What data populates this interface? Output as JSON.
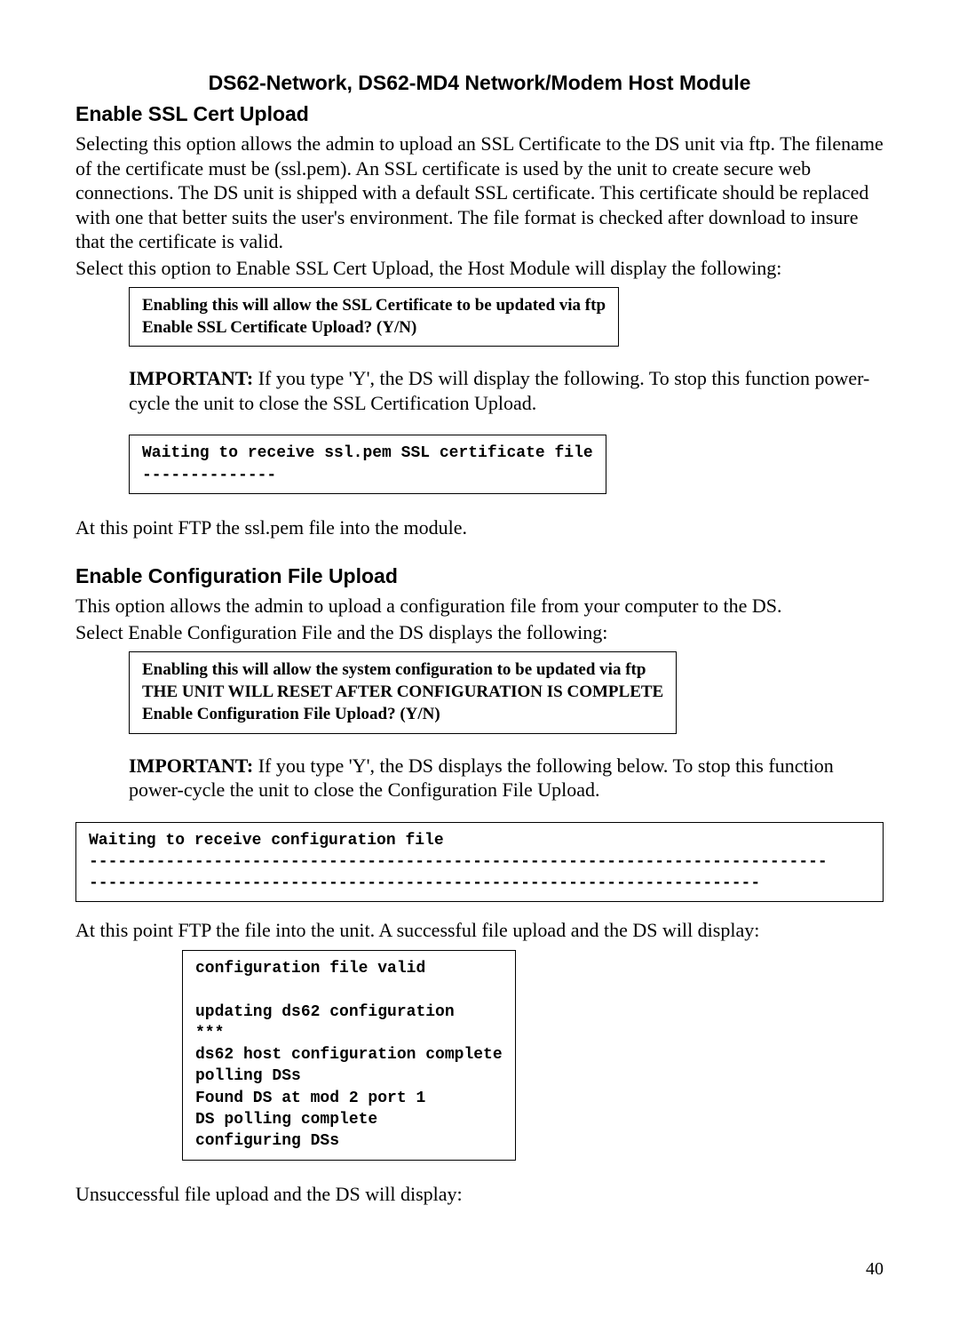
{
  "header_title": "DS62-Network, DS62-MD4 Network/Modem Host Module",
  "section1": {
    "heading": "Enable SSL Cert Upload",
    "para1": "Selecting this option allows the admin to upload an SSL Certificate to the DS unit via ftp. The filename of the certificate must be (ssl.pem). An SSL certificate is used by the unit to create secure web connections. The DS unit is shipped with a default SSL certificate. This certificate should be replaced with one that better suits the user's environment. The file format is checked after download to insure that the certificate is valid.",
    "para2": "Select this option to Enable SSL Cert Upload, the Host Module will display the following:",
    "box1": "Enabling this will allow the SSL Certificate to be updated via ftp\nEnable SSL Certificate Upload? (Y/N)",
    "important_label": "IMPORTANT:",
    "important_text": " If you type 'Y', the DS will display the following. To stop this function power-cycle the unit to close the SSL Certification Upload.",
    "box2": "Waiting to receive ssl.pem SSL certificate file\n--------------",
    "para3": "At this point FTP the ssl.pem file into the module."
  },
  "section2": {
    "heading": "Enable Configuration File Upload",
    "para1": "This option allows the admin to upload a configuration file from your computer to the DS.",
    "para2": "Select Enable Configuration File and the DS displays the following:",
    "box1": "Enabling this will allow the system configuration to be updated via ftp\nTHE UNIT WILL RESET AFTER CONFIGURATION IS COMPLETE\nEnable Configuration File Upload? (Y/N)",
    "important_label": "IMPORTANT:",
    "important_text": " If you type 'Y', the DS displays the following below. To stop this function power-cycle the unit to close the Configuration File Upload.",
    "box2": "Waiting to receive configuration file\n-----------------------------------------------------------------------------\n----------------------------------------------------------------------",
    "para3": "At this point FTP the file into the unit. A successful file upload and the DS will display:",
    "box3": "configuration file valid\n\nupdating ds62 configuration\n***\nds62 host configuration complete\npolling DSs\nFound DS at mod 2 port 1\nDS polling complete\nconfiguring DSs",
    "para4": "Unsuccessful file upload and the DS will display:"
  },
  "page_number": "40"
}
